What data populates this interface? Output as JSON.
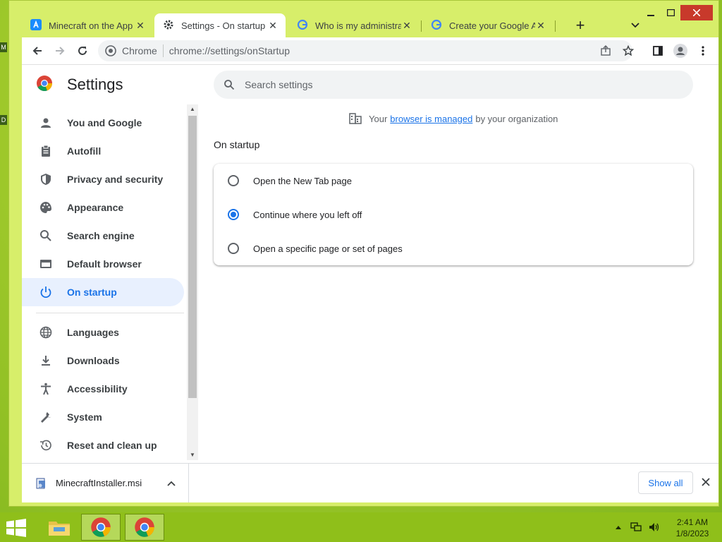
{
  "desktop": {
    "icon_letters": [
      "M",
      "D"
    ]
  },
  "tabs": [
    {
      "title": "Minecraft on the App S",
      "icon": "app-store-icon"
    },
    {
      "title": "Settings - On startup",
      "icon": "gear-icon"
    },
    {
      "title": "Who is my administrato",
      "icon": "google-icon"
    },
    {
      "title": "Create your Google Ac",
      "icon": "google-icon"
    }
  ],
  "new_tab_label": "+",
  "toolbar": {
    "chip": "Chrome",
    "url": "chrome://settings/onStartup"
  },
  "settings": {
    "title": "Settings",
    "search_placeholder": "Search settings",
    "managed": {
      "prefix": "Your",
      "link": "browser is managed",
      "suffix": "by your organization"
    },
    "section_title": "On startup",
    "options": [
      {
        "label": "Open the New Tab page",
        "checked": false
      },
      {
        "label": "Continue where you left off",
        "checked": true
      },
      {
        "label": "Open a specific page or set of pages",
        "checked": false
      }
    ],
    "nav": [
      {
        "label": "You and Google",
        "icon": "person-icon"
      },
      {
        "label": "Autofill",
        "icon": "clipboard-icon"
      },
      {
        "label": "Privacy and security",
        "icon": "shield-icon"
      },
      {
        "label": "Appearance",
        "icon": "palette-icon"
      },
      {
        "label": "Search engine",
        "icon": "search-icon"
      },
      {
        "label": "Default browser",
        "icon": "browser-icon"
      },
      {
        "label": "On startup",
        "icon": "power-icon",
        "active": true
      },
      {
        "label": "Languages",
        "icon": "globe-icon"
      },
      {
        "label": "Downloads",
        "icon": "download-icon"
      },
      {
        "label": "Accessibility",
        "icon": "accessibility-icon"
      },
      {
        "label": "System",
        "icon": "wrench-icon"
      },
      {
        "label": "Reset and clean up",
        "icon": "history-icon"
      }
    ]
  },
  "downloads": {
    "file": "MinecraftInstaller.msi",
    "show_all": "Show all"
  },
  "taskbar": {
    "time": "2:41 AM",
    "date": "1/8/2023"
  },
  "colors": {
    "accent": "#1a73e8",
    "desktop": "#9fc92b",
    "frame": "#d7ee6a"
  }
}
